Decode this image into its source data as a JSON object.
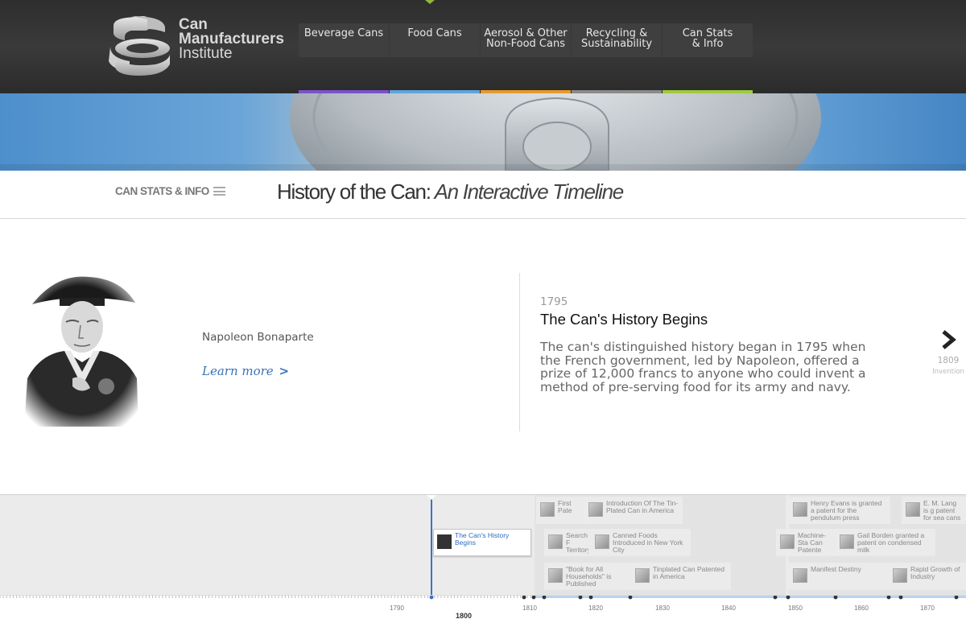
{
  "logo": {
    "line1": "Can",
    "line2": "Manufacturers",
    "line3": "Institute"
  },
  "nav": [
    {
      "label": "Beverage Cans",
      "color": "#7b52c9"
    },
    {
      "label": "Food Cans",
      "color": "#5fa5d9"
    },
    {
      "label": "Aerosol & Other\nNon-Food Cans",
      "color": "#e59a2c"
    },
    {
      "label": "Recycling &\nSustainability",
      "color": "#8a8a8a"
    },
    {
      "label": "Can Stats\n& Info",
      "color": "#9ecb3c"
    }
  ],
  "section_link": "CAN STATS & INFO",
  "page_title": {
    "main": "History of the Can:",
    "italic": " An Interactive Timeline"
  },
  "media": {
    "caption": "Napoleon Bonaparte",
    "learn_more": "Learn more",
    "chevron": ">"
  },
  "event": {
    "date": "1795",
    "title": "The Can's History Begins",
    "description": "The can's distinguished history began in 1795 when the French government, led by Napoleon, offered a prize of 12,000 francs to anyone who could invent a method of pre-serving food for its army and navy."
  },
  "next": {
    "glyph": "›",
    "year": "1809",
    "label": "Invention"
  },
  "timeline": {
    "markers": [
      {
        "text": "The Can's History Begins",
        "active": true
      },
      {
        "text": "First Pate",
        "active": false
      },
      {
        "text": "Introduction Of The Tin-Plated Can in America",
        "active": false
      },
      {
        "text": "Search F Territory",
        "active": false
      },
      {
        "text": "Canned Foods Introduced in New York City",
        "active": false
      },
      {
        "text": "\"Book for All Households\" is Published",
        "active": false
      },
      {
        "text": "Tinplated Can Patented in America",
        "active": false
      },
      {
        "text": "Henry Evans is granted a patent for the pendulum press",
        "active": false
      },
      {
        "text": "Machine-Sta Can Patente",
        "active": false
      },
      {
        "text": "Gail Borden granted a patent on condensed milk",
        "active": false
      },
      {
        "text": "Manifest Destiny",
        "active": false
      },
      {
        "text": "E. M. Lang is g patent for sea cans",
        "active": false
      },
      {
        "text": "Rapid Growth of Industry",
        "active": false
      }
    ],
    "tick_labels": [
      "1790",
      "1810",
      "1820",
      "1830",
      "1840",
      "1850",
      "1860",
      "1870"
    ],
    "major_label": "1800"
  }
}
